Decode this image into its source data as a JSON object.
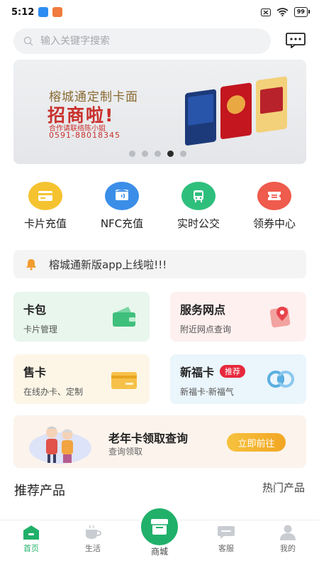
{
  "status": {
    "time": "5:12",
    "battery": "99"
  },
  "search": {
    "placeholder": "输入关键字搜索"
  },
  "banner": {
    "line1": "榕城通定制卡面",
    "line2": "招商啦!",
    "contact": "合作请联络陈小姐",
    "phone": "0591-88018345",
    "active_slide": 4,
    "slide_count": 5
  },
  "quick_menu": [
    {
      "label": "卡片充值",
      "icon": "card-recharge-icon",
      "color": "#f5c330"
    },
    {
      "label": "NFC充值",
      "icon": "nfc-icon",
      "color": "#3b8ee8"
    },
    {
      "label": "实时公交",
      "icon": "bus-icon",
      "color": "#2fbf7d"
    },
    {
      "label": "领券中心",
      "icon": "coupon-icon",
      "color": "#ef5b4c"
    }
  ],
  "notice": {
    "text": "榕城通新版app上线啦!!!"
  },
  "services": [
    {
      "title": "卡包",
      "subtitle": "卡片管理",
      "bg": "#e8f6ed",
      "icon": "wallet-icon"
    },
    {
      "title": "服务网点",
      "subtitle": "附近网点查询",
      "bg": "#fdf0ef",
      "icon": "map-location-icon"
    },
    {
      "title": "售卡",
      "subtitle": "在线办卡、定制",
      "bg": "#fdf6e7",
      "icon": "sell-card-icon"
    },
    {
      "title": "新福卡",
      "subtitle": "新福卡·新福气",
      "bg": "#eaf5fc",
      "icon": "fu-card-icon",
      "badge": "推荐"
    }
  ],
  "elder": {
    "title": "老年卡领取查询",
    "subtitle": "查询领取",
    "button": "立即前往"
  },
  "section": {
    "title": "推荐产品",
    "more": "热门产品"
  },
  "tabbar": {
    "items": [
      {
        "label": "首页",
        "icon": "home-icon"
      },
      {
        "label": "生活",
        "icon": "coffee-icon"
      },
      {
        "label": "商城",
        "icon": "shop-icon"
      },
      {
        "label": "客服",
        "icon": "chat-icon"
      },
      {
        "label": "我的",
        "icon": "user-icon"
      }
    ],
    "active": "首页",
    "accent": "#21b06a"
  }
}
